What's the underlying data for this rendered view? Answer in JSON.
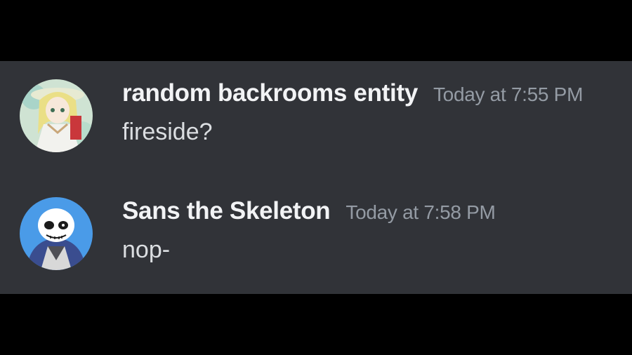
{
  "colors": {
    "background": "#313338",
    "letterbox": "#000000",
    "username": "#f2f3f5",
    "timestamp": "#949ba4",
    "message_text": "#dbdee1"
  },
  "messages": [
    {
      "username": "random backrooms entity",
      "timestamp": "Today at 7:55 PM",
      "text": "fireside?",
      "avatar_icon": "anime-girl-avatar"
    },
    {
      "username": "Sans the Skeleton",
      "timestamp": "Today at 7:58 PM",
      "text": "nop-",
      "avatar_icon": "skeleton-avatar"
    }
  ]
}
